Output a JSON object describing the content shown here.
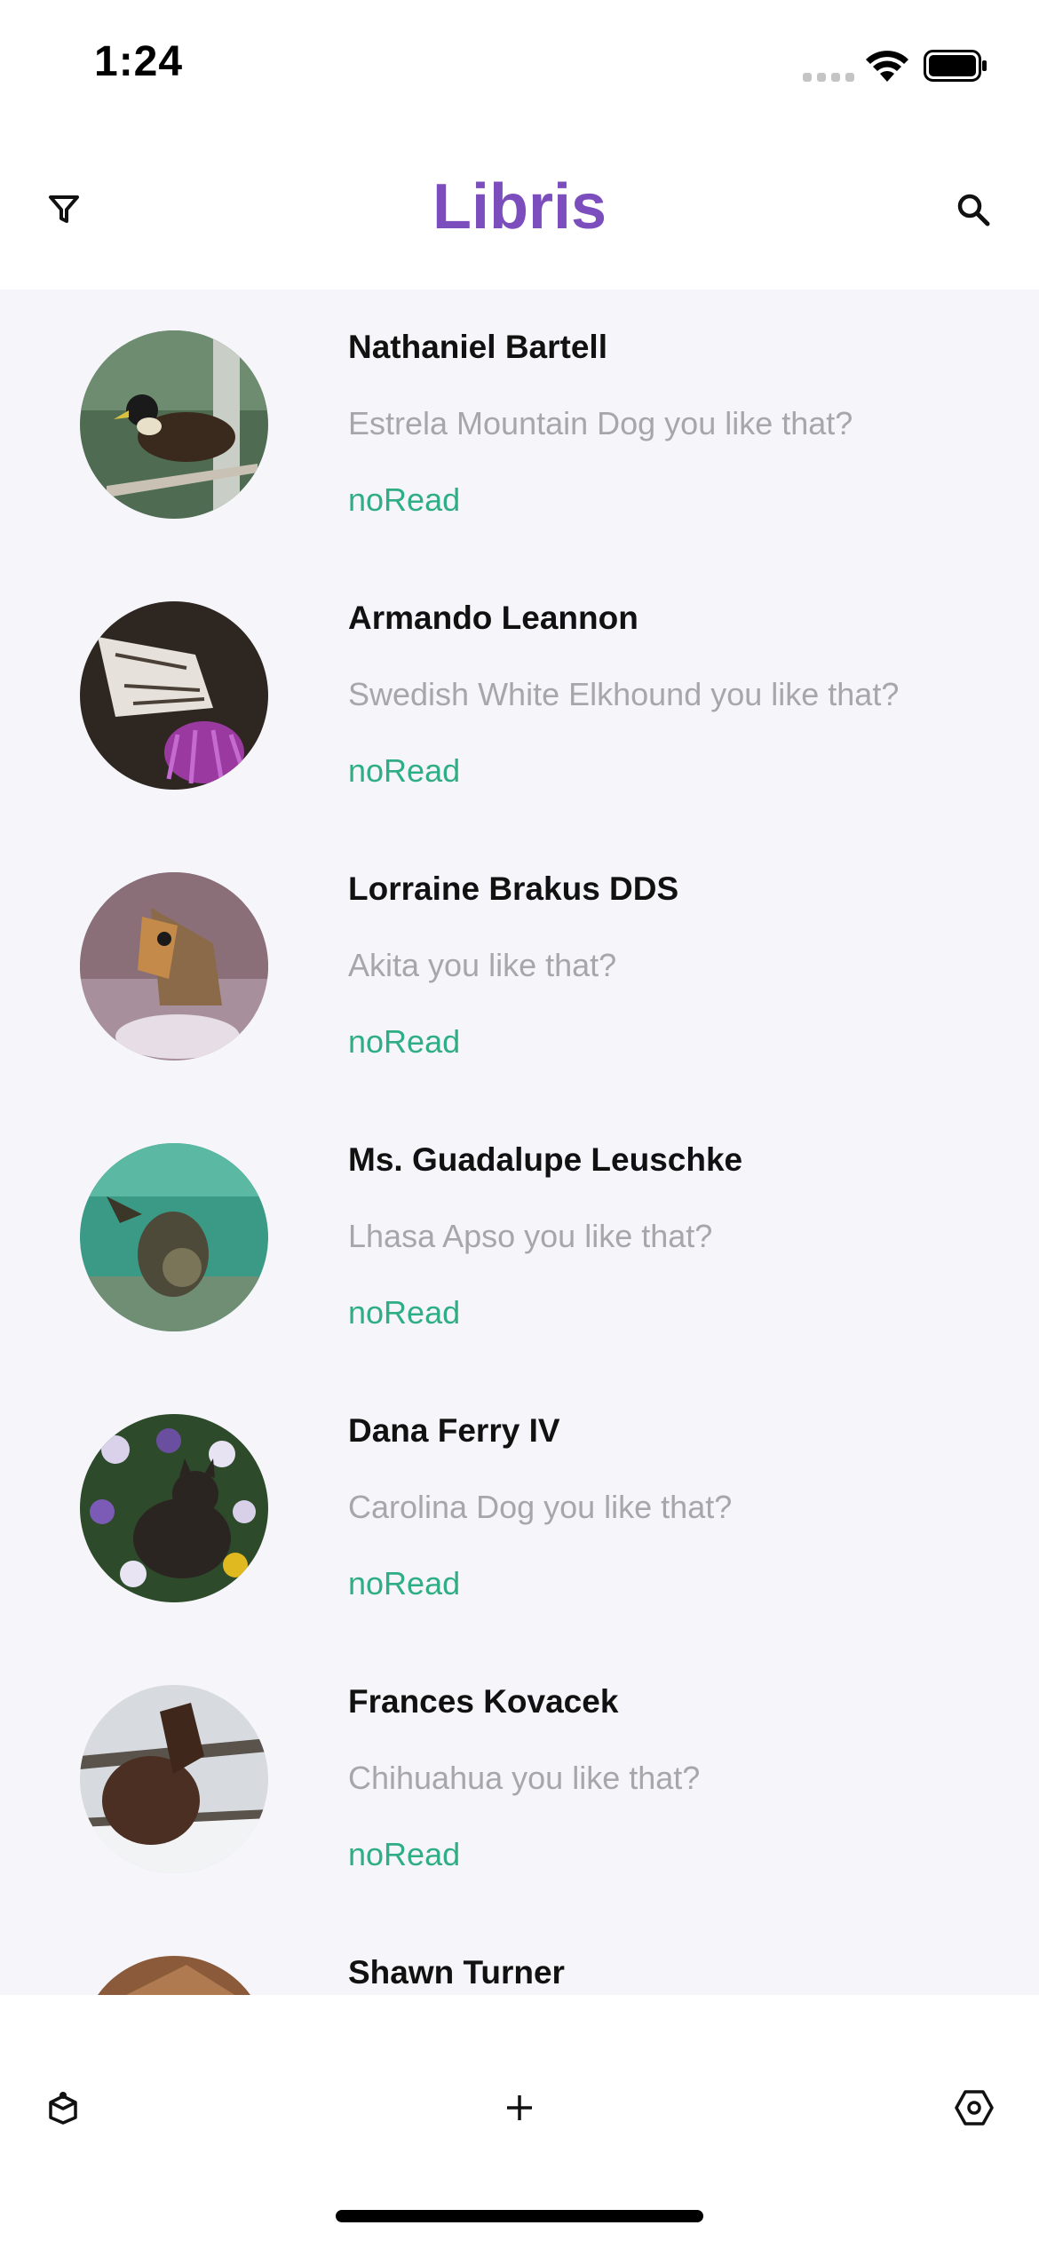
{
  "status_bar": {
    "time": "1:24"
  },
  "header": {
    "title": "Libris"
  },
  "conversations": [
    {
      "name": "Nathaniel Bartell",
      "message": "Estrela Mountain Dog you like that?",
      "status": "noRead",
      "avatar": "bird-photo"
    },
    {
      "name": "Armando Leannon",
      "message": "Swedish White Elkhound you like that?",
      "status": "noRead",
      "avatar": "butterfly-on-thistle-photo"
    },
    {
      "name": "Lorraine Brakus DDS",
      "message": "Akita you like that?",
      "status": "noRead",
      "avatar": "brown-butterfly-photo"
    },
    {
      "name": "Ms. Guadalupe Leuschke",
      "message": "Lhasa Apso you like that?",
      "status": "noRead",
      "avatar": "sea-lion-underwater-photo"
    },
    {
      "name": "Dana Ferry IV",
      "message": "Carolina Dog you like that?",
      "status": "noRead",
      "avatar": "cat-in-flowers-photo"
    },
    {
      "name": "Frances Kovacek",
      "message": "Chihuahua you like that?",
      "status": "noRead",
      "avatar": "horse-in-snow-photo"
    },
    {
      "name": "Shawn Turner",
      "message": "",
      "status": "",
      "avatar": "autumn-leaf-photo"
    }
  ],
  "tabbar": {
    "left_icon": "box-icon",
    "center_icon": "plus-icon",
    "right_icon": "hexagon-settings-icon"
  },
  "colors": {
    "accent": "#7c4dbd",
    "unread": "#2fae84",
    "list_bg": "#f5f5fa",
    "muted_text": "#a6a6ab"
  }
}
